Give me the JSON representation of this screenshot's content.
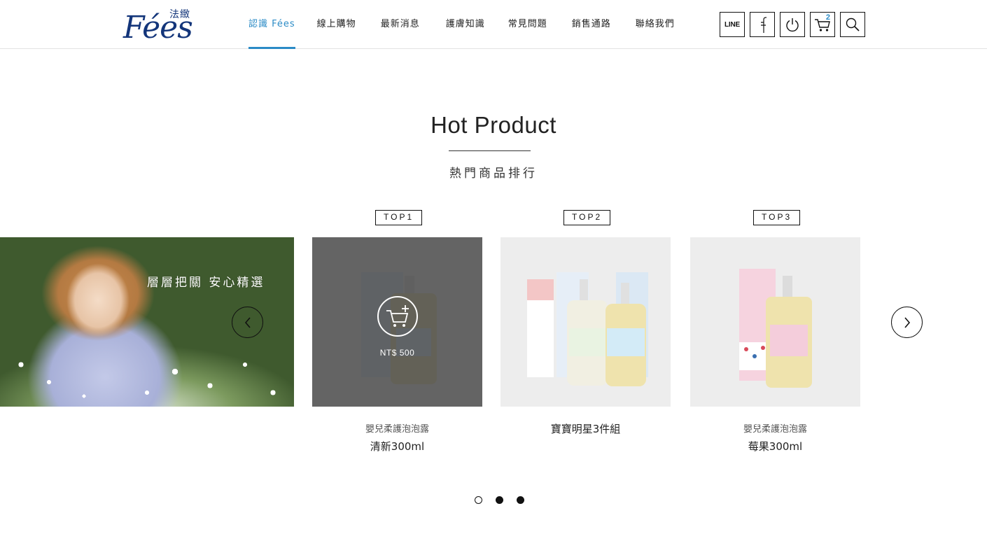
{
  "brand": {
    "latin": "Fées",
    "cjk": "法緻"
  },
  "nav": [
    {
      "label": "認識 Fées",
      "active": true
    },
    {
      "label": "線上購物"
    },
    {
      "label": "最新消息"
    },
    {
      "label": "護膚知識"
    },
    {
      "label": "常見問題"
    },
    {
      "label": "銷售通路"
    },
    {
      "label": "聯絡我們"
    }
  ],
  "header_icons": {
    "line_label": "LINE",
    "cart_count": "2",
    "items": [
      "line-icon",
      "facebook-icon",
      "power-icon",
      "cart-icon",
      "search-icon"
    ]
  },
  "section": {
    "title": "Hot Product",
    "subtitle": "熱門商品排行"
  },
  "banner": {
    "text": "層層把關 安心精選"
  },
  "products": [
    {
      "rank": "TOP1",
      "line1": "嬰兒柔護泡泡露",
      "line2": "清新300ml",
      "price": "NT$ 500",
      "hover": true
    },
    {
      "rank": "TOP2",
      "line1": "寶寶明星3件組"
    },
    {
      "rank": "TOP3",
      "line1": "嬰兒柔護泡泡露",
      "line2": "莓果300ml"
    }
  ],
  "pagination": {
    "count": 3,
    "active": 0
  },
  "colors": {
    "accent": "#2b8bc6",
    "brand": "#13357a",
    "overlay": "#464646"
  }
}
